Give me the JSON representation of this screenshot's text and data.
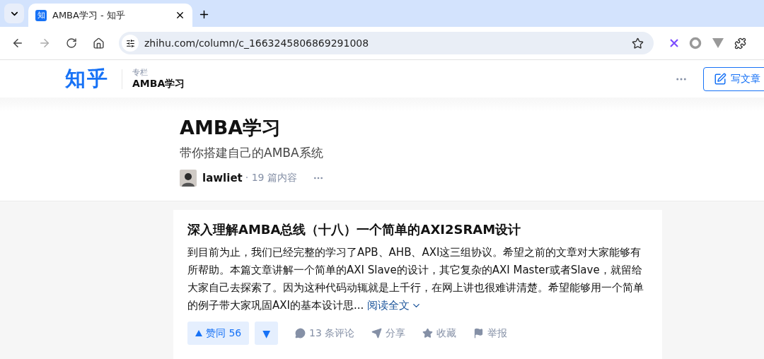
{
  "browser": {
    "tab": {
      "title": "AMBA学习 - 知乎",
      "favicon": "知",
      "selected": true
    },
    "url": "zhihu.com/column/c_1663245806869291008"
  },
  "header": {
    "logo": "知乎",
    "section_label": "专栏",
    "section_title": "AMBA学习",
    "write_button": "写文章"
  },
  "column": {
    "title": "AMBA学习",
    "description": "带你搭建自己的AMBA系统",
    "author": "lawliet",
    "meta": "· 19 篇内容"
  },
  "article": {
    "title": "深入理解AMBA总线（十八）一个简单的AXI2SRAM设计",
    "excerpt": "到目前为止，我们已经完整的学习了APB、AHB、AXI这三组协议。希望之前的文章对大家能够有所帮助。本篇文章讲解一个简单的AXI Slave的设计，其它复杂的AXI Master或者Slave，就留给大家自己去探索了。因为这种代码动辄就是上千行，在网上讲也很难讲清楚。希望能够用一个简单的例子带大家巩固AXI的基本设计思...",
    "read_more": "阅读全文",
    "actions": [
      {
        "kind": "upvote",
        "label": "赞同 56"
      },
      {
        "kind": "downvote",
        "label": "▼"
      },
      {
        "kind": "comment",
        "label": "13 条评论"
      },
      {
        "kind": "share",
        "label": "分享"
      },
      {
        "kind": "favorite",
        "label": "收藏"
      },
      {
        "kind": "report",
        "label": "举报"
      }
    ]
  }
}
